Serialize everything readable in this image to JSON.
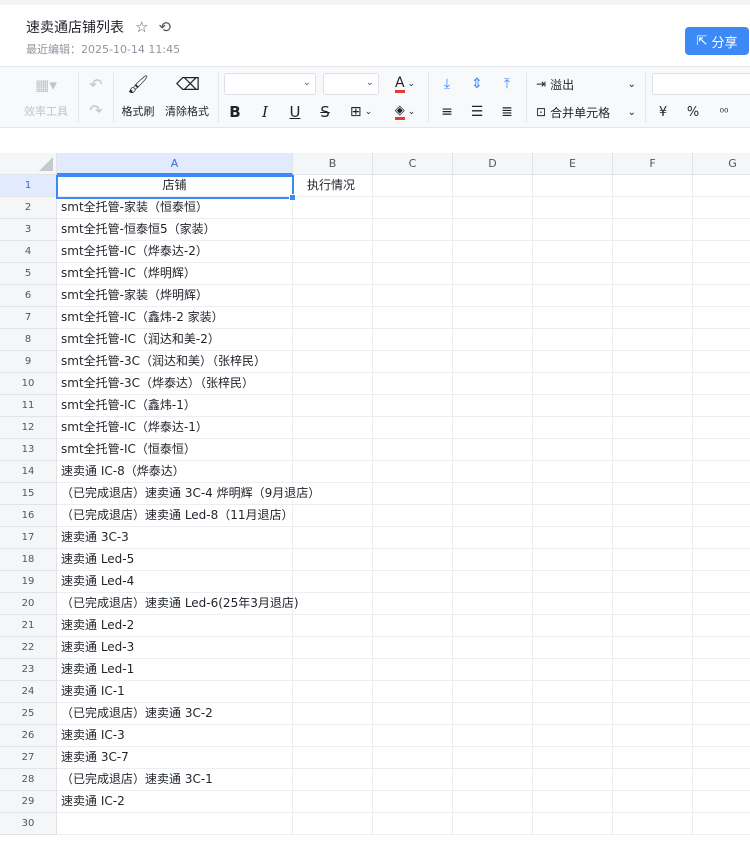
{
  "doc": {
    "title": "速卖通店铺列表",
    "last_edited": "最近编辑：2025-10-14 11:45",
    "share_label": "分享"
  },
  "toolbar": {
    "efficiency_tools": "效率工具",
    "format_painter": "格式刷",
    "clear_format": "清除格式",
    "font_family_value": "",
    "font_size_value": "",
    "overflow_label": "溢出",
    "merge_cells_label": "合并单元格",
    "currency_symbol": "¥",
    "percent_symbol": "%"
  },
  "colors": {
    "accent": "#3d8af7",
    "font_color_bar": "#e53935",
    "fill_color_bar": "#e53935"
  },
  "sheet": {
    "columns": [
      "A",
      "B",
      "C",
      "D",
      "E",
      "F",
      "G"
    ],
    "rows": [
      {
        "n": "1",
        "a": "店铺",
        "b": "执行情况"
      },
      {
        "n": "2",
        "a": "smt全托管-家装（恒泰恒）",
        "b": ""
      },
      {
        "n": "3",
        "a": "smt全托管-恒泰恒5（家装）",
        "b": ""
      },
      {
        "n": "4",
        "a": "smt全托管-IC（烨泰达-2）",
        "b": ""
      },
      {
        "n": "5",
        "a": "smt全托管-IC（烨明辉）",
        "b": ""
      },
      {
        "n": "6",
        "a": "smt全托管-家装（烨明辉）",
        "b": ""
      },
      {
        "n": "7",
        "a": "smt全托管-IC（鑫炜-2 家装）",
        "b": ""
      },
      {
        "n": "8",
        "a": "smt全托管-IC（润达和美-2）",
        "b": ""
      },
      {
        "n": "9",
        "a": "smt全托管-3C（润达和美）（张梓民）",
        "b": ""
      },
      {
        "n": "10",
        "a": "smt全托管-3C（烨泰达）（张梓民）",
        "b": ""
      },
      {
        "n": "11",
        "a": "smt全托管-IC（鑫炜-1）",
        "b": ""
      },
      {
        "n": "12",
        "a": "smt全托管-IC（烨泰达-1）",
        "b": ""
      },
      {
        "n": "13",
        "a": "smt全托管-IC（恒泰恒）",
        "b": ""
      },
      {
        "n": "14",
        "a": "速卖通 IC-8（烨泰达）",
        "b": ""
      },
      {
        "n": "15",
        "a": "（已完成退店）速卖通 3C-4 烨明辉（9月退店）",
        "b": ""
      },
      {
        "n": "16",
        "a": "（已完成退店）速卖通 Led-8（11月退店）",
        "b": ""
      },
      {
        "n": "17",
        "a": "速卖通 3C-3",
        "b": ""
      },
      {
        "n": "18",
        "a": "速卖通 Led-5",
        "b": ""
      },
      {
        "n": "19",
        "a": "速卖通 Led-4",
        "b": ""
      },
      {
        "n": "20",
        "a": "（已完成退店）速卖通 Led-6(25年3月退店)",
        "b": ""
      },
      {
        "n": "21",
        "a": "速卖通 Led-2",
        "b": ""
      },
      {
        "n": "22",
        "a": "速卖通 Led-3",
        "b": ""
      },
      {
        "n": "23",
        "a": "速卖通 Led-1",
        "b": ""
      },
      {
        "n": "24",
        "a": "速卖通 IC-1",
        "b": ""
      },
      {
        "n": "25",
        "a": "（已完成退店）速卖通 3C-2",
        "b": ""
      },
      {
        "n": "26",
        "a": "速卖通 IC-3",
        "b": ""
      },
      {
        "n": "27",
        "a": "速卖通 3C-7",
        "b": ""
      },
      {
        "n": "28",
        "a": "（已完成退店）速卖通 3C-1",
        "b": ""
      },
      {
        "n": "29",
        "a": "速卖通 IC-2",
        "b": ""
      },
      {
        "n": "30",
        "a": "",
        "b": ""
      }
    ]
  }
}
